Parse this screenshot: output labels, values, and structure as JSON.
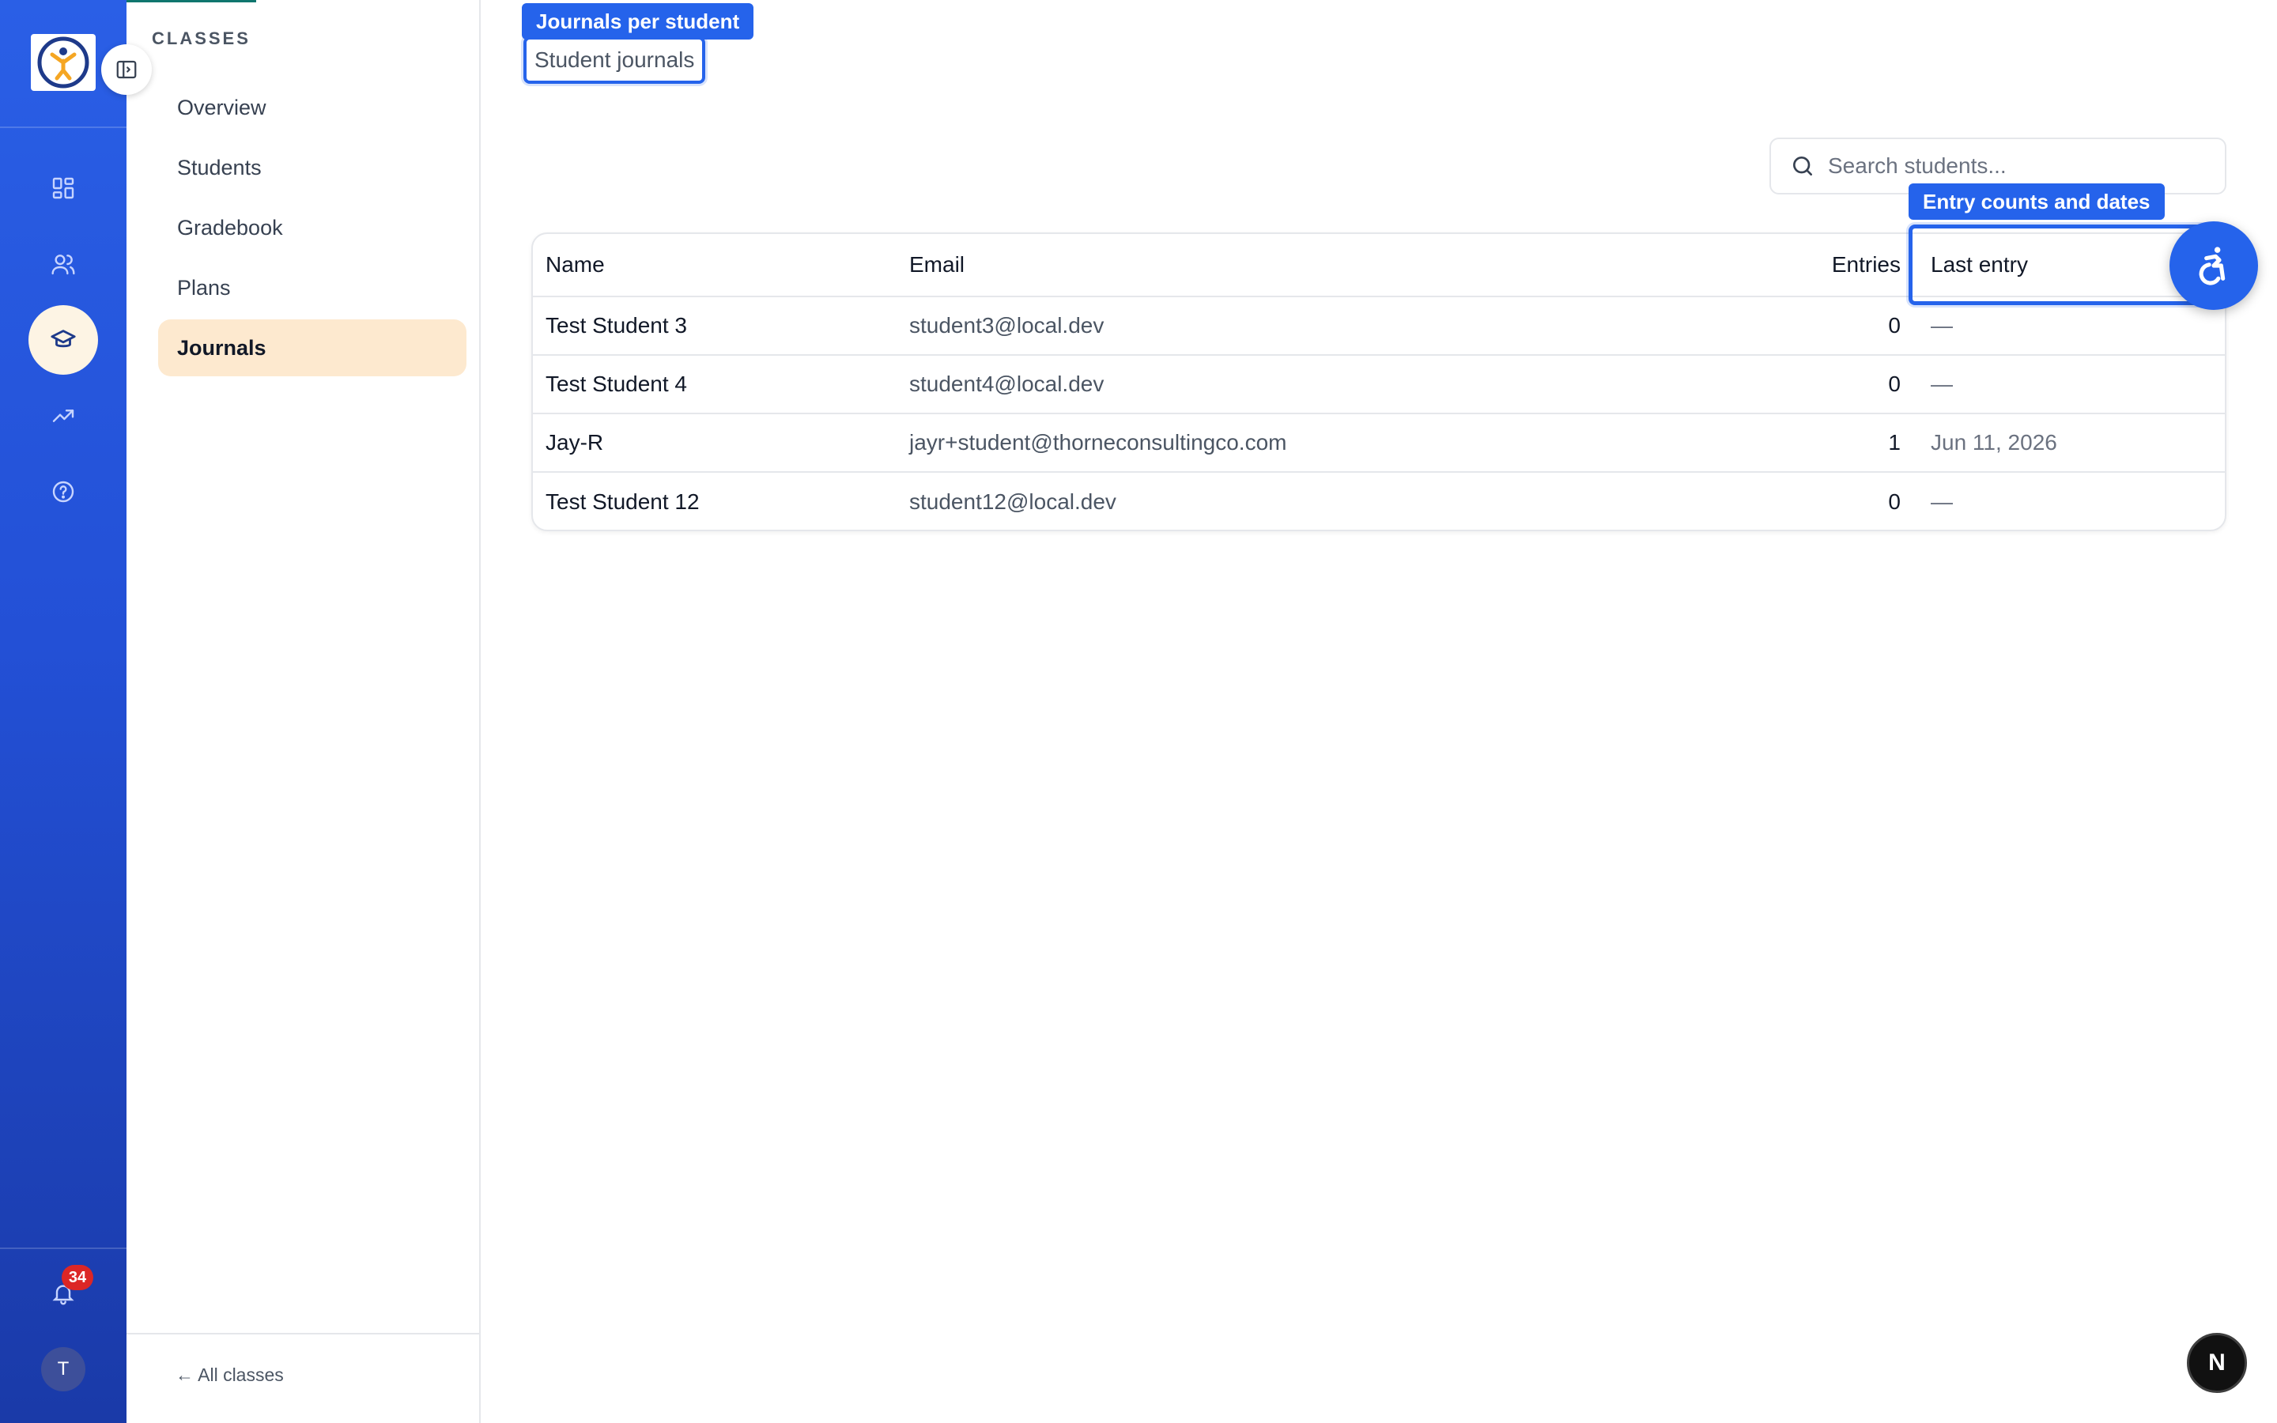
{
  "sidebar": {
    "heading": "CLASSES",
    "items": [
      {
        "label": "Overview"
      },
      {
        "label": "Students"
      },
      {
        "label": "Gradebook"
      },
      {
        "label": "Plans"
      },
      {
        "label": "Journals"
      }
    ],
    "active_item": "Journals",
    "back_link": "← All classes"
  },
  "rail": {
    "icons": [
      "dashboard-icon",
      "users-icon",
      "graduation-cap-icon",
      "trending-up-icon",
      "help-circle-icon"
    ],
    "active_icon": "graduation-cap-icon",
    "notifications_count": "34",
    "avatar_initial": "T"
  },
  "page": {
    "title_tag": "Journals per student",
    "title": "Student journals"
  },
  "search": {
    "placeholder": "Search students..."
  },
  "table": {
    "headers": {
      "name": "Name",
      "email": "Email",
      "entries": "Entries",
      "last_entry": "Last entry"
    },
    "column_tag": "Entry counts and dates",
    "rows": [
      {
        "name": "Test Student 3",
        "email": "student3@local.dev",
        "entries": "0",
        "last_entry": "—"
      },
      {
        "name": "Test Student 4",
        "email": "student4@local.dev",
        "entries": "0",
        "last_entry": "—"
      },
      {
        "name": "Jay-R",
        "email": "jayr+student@thorneconsultingco.com",
        "entries": "1",
        "last_entry": "Jun 11, 2026"
      },
      {
        "name": "Test Student 12",
        "email": "student12@local.dev",
        "entries": "0",
        "last_entry": "—"
      }
    ]
  },
  "floating": {
    "next_badge": "N"
  },
  "colors": {
    "rail_gradient_top": "#2a5fe6",
    "rail_gradient_bottom": "#1a3aa8",
    "accent": "#2563eb",
    "active_nav_bg": "#fde9cf",
    "badge": "#dc2626"
  }
}
